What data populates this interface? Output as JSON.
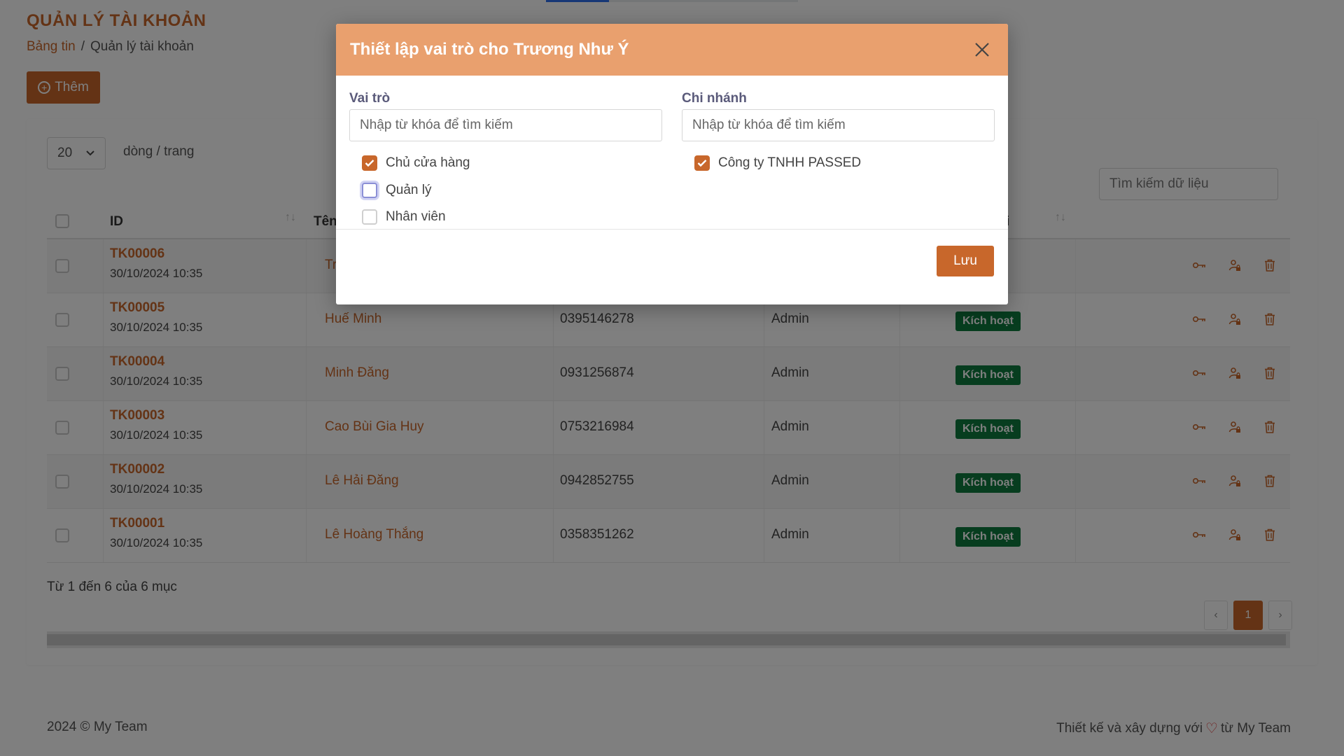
{
  "page": {
    "title": "QUẢN LÝ TÀI KHOẢN",
    "breadcrumb": [
      "Bảng tin",
      "/",
      "Quản lý tài khoản"
    ],
    "add_label": "Thêm",
    "page_size": "20",
    "page_size_label": "dòng / trang",
    "search_placeholder": "Tìm kiếm dữ liệu",
    "progress": 0.25
  },
  "table": {
    "headers": {
      "id": "ID",
      "name": "Tên",
      "status_partial": "i"
    },
    "rows": [
      {
        "id": "TK00006",
        "time": "30/10/2024 10:35",
        "name": "Tr",
        "phone": "",
        "role": "",
        "status": "t"
      },
      {
        "id": "TK00005",
        "time": "30/10/2024 10:35",
        "name": "Huế Minh",
        "phone": "0395146278",
        "role": "Admin",
        "status": "Kích hoạt"
      },
      {
        "id": "TK00004",
        "time": "30/10/2024 10:35",
        "name": "Minh Đăng",
        "phone": "0931256874",
        "role": "Admin",
        "status": "Kích hoạt"
      },
      {
        "id": "TK00003",
        "time": "30/10/2024 10:35",
        "name": "Cao Bùi Gia Huy",
        "phone": "0753216984",
        "role": "Admin",
        "status": "Kích hoạt"
      },
      {
        "id": "TK00002",
        "time": "30/10/2024 10:35",
        "name": "Lê Hải Đăng",
        "phone": "0942852755",
        "role": "Admin",
        "status": "Kích hoạt"
      },
      {
        "id": "TK00001",
        "time": "30/10/2024 10:35",
        "name": "Lê Hoàng Thắng",
        "phone": "0358351262",
        "role": "Admin",
        "status": "Kích hoạt"
      }
    ],
    "icons": [
      "key-icon",
      "user-lock-icon",
      "trash-icon"
    ],
    "summary": "Từ 1 đến 6 của 6 mục",
    "pager": {
      "prev": "‹",
      "current": "1",
      "next": "›"
    }
  },
  "footer": {
    "left": "2024 © My Team",
    "right_before": "Thiết kế và xây dựng với",
    "right_after": "từ My Team"
  },
  "modal": {
    "title": "Thiết lập vai trò cho Trương Như Ý",
    "role_label": "Vai trò",
    "role_placeholder": "Nhập từ khóa để tìm kiếm",
    "branch_label": "Chi nhánh",
    "branch_placeholder": "Nhập từ khóa để tìm kiếm",
    "roles": [
      {
        "label": "Chủ cửa hàng",
        "checked": true
      },
      {
        "label": "Quản lý",
        "checked": false
      },
      {
        "label": "Nhân viên",
        "checked": false
      }
    ],
    "branches": [
      {
        "label": "Công ty TNHH PASSED",
        "checked": true
      }
    ],
    "save_label": "Lưu"
  },
  "colors": {
    "accent": "#c8672b",
    "modal_header": "#e9a06e",
    "status_green": "#0e7a3e"
  }
}
